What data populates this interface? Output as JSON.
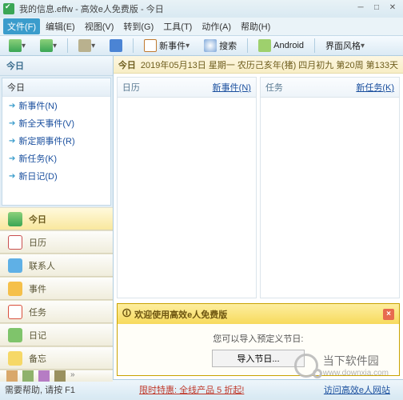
{
  "window": {
    "title": "我的信息.effw - 高效e人免费版 - 今日"
  },
  "menu": {
    "file": "文件(F)",
    "items": [
      "编辑(E)",
      "视图(V)",
      "转到(G)",
      "工具(T)",
      "动作(A)",
      "帮助(H)"
    ]
  },
  "toolbar": {
    "new_event": "新事件",
    "search": "搜索",
    "android": "Android",
    "skin": "界面风格"
  },
  "sidebar": {
    "header": "今日",
    "panel_title": "今日",
    "quick_items": [
      "新事件(N)",
      "新全天事件(V)",
      "新定期事件(R)",
      "新任务(K)",
      "新日记(D)"
    ],
    "nav": [
      {
        "label": "今日"
      },
      {
        "label": "日历"
      },
      {
        "label": "联系人"
      },
      {
        "label": "事件"
      },
      {
        "label": "任务"
      },
      {
        "label": "日记"
      },
      {
        "label": "备忘"
      }
    ]
  },
  "main": {
    "today_label": "今日",
    "date_line": "2019年05月13日 星期一 农历己亥年(猪) 四月初九  第20周  第133天",
    "col1": {
      "head": "日历",
      "action": "新事件(N)"
    },
    "col2": {
      "head": "任务",
      "action": "新任务(K)"
    }
  },
  "welcome": {
    "title": "欢迎使用高效e人免费版",
    "text": "您可以导入预定义节日:",
    "button": "导入节日..."
  },
  "status": {
    "help": "需要帮助, 请按 F1",
    "promo": "限时特惠: 全线产品 5 折起!",
    "site": "访问高效e人网站"
  },
  "watermark": {
    "brand": "当下软件园",
    "url": "www.downxia.com"
  }
}
